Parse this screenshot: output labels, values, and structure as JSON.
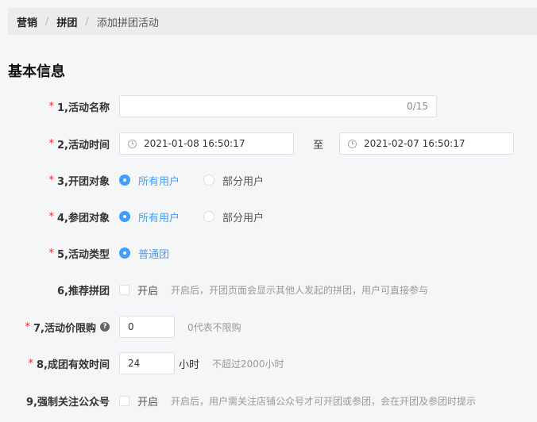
{
  "breadcrumb": {
    "items": [
      "营销",
      "拼团"
    ],
    "current": "添加拼团活动",
    "separator": "/"
  },
  "section": {
    "title": "基本信息"
  },
  "required_mark": "*",
  "fields": {
    "name": {
      "label": "1,活动名称",
      "value": "",
      "counter": "0/15"
    },
    "time": {
      "label": "2,活动时间",
      "start": "2021-01-08 16:50:17",
      "to": "至",
      "end": "2021-02-07 16:50:17"
    },
    "open_target": {
      "label": "3,开团对象",
      "options": [
        "所有用户",
        "部分用户"
      ],
      "selected": "所有用户"
    },
    "join_target": {
      "label": "4,参团对象",
      "options": [
        "所有用户",
        "部分用户"
      ],
      "selected": "所有用户"
    },
    "type": {
      "label": "5,活动类型",
      "options": [
        "普通团"
      ],
      "selected": "普通团"
    },
    "recommend": {
      "label": "6,推荐拼团",
      "checkbox_label": "开启",
      "checked": false,
      "hint": "开启后，开团页面会显示其他人发起的拼团，用户可直接参与"
    },
    "price_limit": {
      "label": "7,活动价限购",
      "value": "0",
      "hint": "0代表不限购",
      "help_icon": "question-circle-icon"
    },
    "valid_time": {
      "label": "8,成团有效时间",
      "value": "24",
      "unit": "小时",
      "hint": "不超过2000小时"
    },
    "follow": {
      "label": "9,强制关注公众号",
      "checkbox_label": "开启",
      "checked": false,
      "hint": "开启后，用户需关注店铺公众号才可开团或参团，会在开团及参团时提示"
    }
  },
  "colors": {
    "accent": "#409eff",
    "required": "#f5222d",
    "background": "#f5f6f8"
  }
}
